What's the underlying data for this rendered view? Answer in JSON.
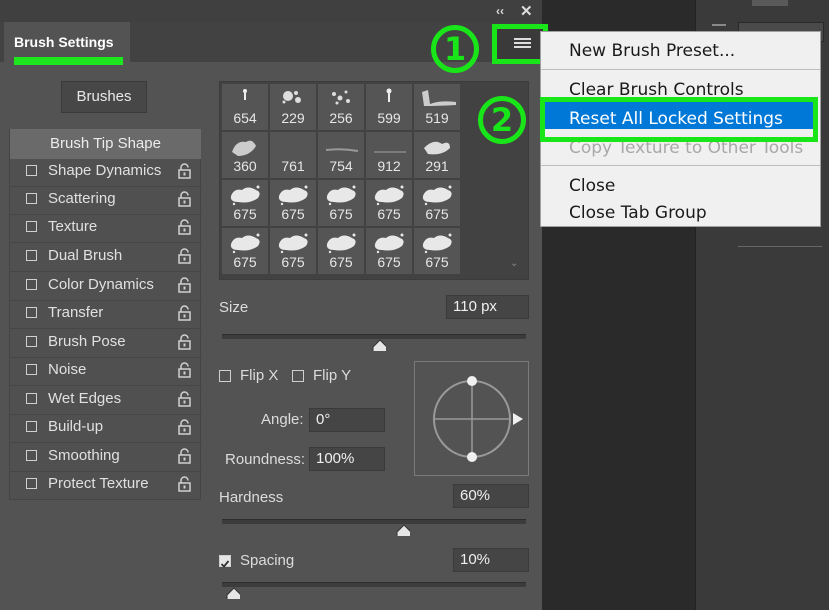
{
  "panel": {
    "tab_title": "Brush Settings",
    "collapse_glyph": "‹‹",
    "close_glyph": "✕",
    "brushes_button": "Brushes"
  },
  "annotations": {
    "badge1": "1",
    "badge2": "2",
    "highlight_color": "#19e619"
  },
  "options": {
    "tip_shape": "Brush Tip Shape",
    "items": [
      {
        "label": "Shape Dynamics",
        "checked": false
      },
      {
        "label": "Scattering",
        "checked": false
      },
      {
        "label": "Texture",
        "checked": false
      },
      {
        "label": "Dual Brush",
        "checked": false
      },
      {
        "label": "Color Dynamics",
        "checked": false
      },
      {
        "label": "Transfer",
        "checked": false
      },
      {
        "label": "Brush Pose",
        "checked": false
      },
      {
        "label": "Noise",
        "checked": false
      },
      {
        "label": "Wet Edges",
        "checked": false
      },
      {
        "label": "Build-up",
        "checked": false
      },
      {
        "label": "Smoothing",
        "checked": false
      },
      {
        "label": "Protect Texture",
        "checked": false
      }
    ]
  },
  "brush_grid": {
    "sizes": [
      "654",
      "229",
      "256",
      "599",
      "519",
      "360",
      "761",
      "754",
      "912",
      "291",
      "675",
      "675",
      "675",
      "675",
      "675",
      "675",
      "675",
      "675",
      "675",
      "675"
    ],
    "scroll_glyph": "⌄"
  },
  "controls": {
    "size_label": "Size",
    "size_value": "110 px",
    "size_slider_fraction": 0.52,
    "flip_x": "Flip X",
    "flip_y": "Flip Y",
    "angle_label": "Angle:",
    "angle_value": "0°",
    "roundness_label": "Roundness:",
    "roundness_value": "100%",
    "hardness_label": "Hardness",
    "hardness_value": "60%",
    "hardness_slider_fraction": 0.6,
    "spacing_label": "Spacing",
    "spacing_checked": true,
    "spacing_value": "10%",
    "spacing_slider_fraction": 0.04
  },
  "menu": {
    "new_brush_preset": "New Brush Preset...",
    "clear_brush_controls": "Clear Brush Controls",
    "reset_all_locked": "Reset All Locked Settings",
    "copy_texture": "Copy Texture to Other Tools",
    "close": "Close",
    "close_tab_group": "Close Tab Group",
    "highlight_color": "#0078d7"
  }
}
